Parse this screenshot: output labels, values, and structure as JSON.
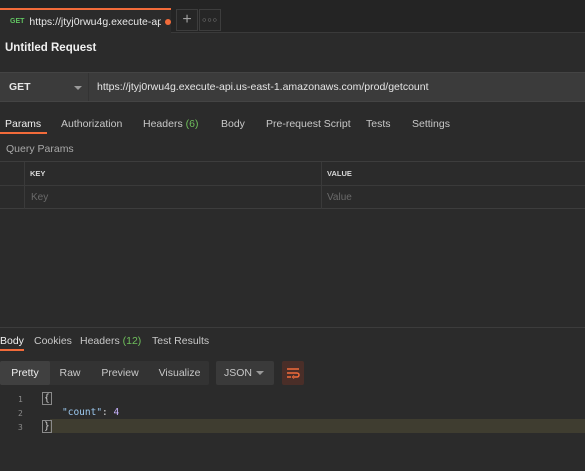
{
  "tab": {
    "method": "GET",
    "title": "https://jtyj0rwu4g.execute-api....",
    "add_icon": "plus-icon",
    "more_icon": "ellipsis-icon"
  },
  "request_title": "Untitled Request",
  "url_bar": {
    "method": "GET",
    "url": "https://jtyj0rwu4g.execute-api.us-east-1.amazonaws.com/prod/getcount"
  },
  "request_tabs": [
    {
      "label": "Params",
      "active": true
    },
    {
      "label": "Authorization"
    },
    {
      "label": "Headers",
      "count": "(6)"
    },
    {
      "label": "Body"
    },
    {
      "label": "Pre-request Script"
    },
    {
      "label": "Tests"
    },
    {
      "label": "Settings"
    }
  ],
  "query_params": {
    "label": "Query Params",
    "headers": [
      "KEY",
      "VALUE"
    ],
    "placeholders": [
      "Key",
      "Value"
    ]
  },
  "response_tabs": [
    {
      "label": "Body",
      "active": true
    },
    {
      "label": "Cookies"
    },
    {
      "label": "Headers",
      "count": "(12)"
    },
    {
      "label": "Test Results"
    }
  ],
  "format_buttons": [
    "Pretty",
    "Raw",
    "Preview",
    "Visualize"
  ],
  "format_select": "JSON",
  "wrap_icon": "wrap-lines-icon",
  "code": {
    "line_numbers": [
      "1",
      "2",
      "3"
    ],
    "open_brace": "{",
    "key": "\"count\"",
    "colon": ": ",
    "value": "4",
    "close_brace": "}"
  },
  "colors": {
    "accent": "#f26b3a",
    "count_green": "#6fbf5c",
    "method_green": "#61c461"
  }
}
